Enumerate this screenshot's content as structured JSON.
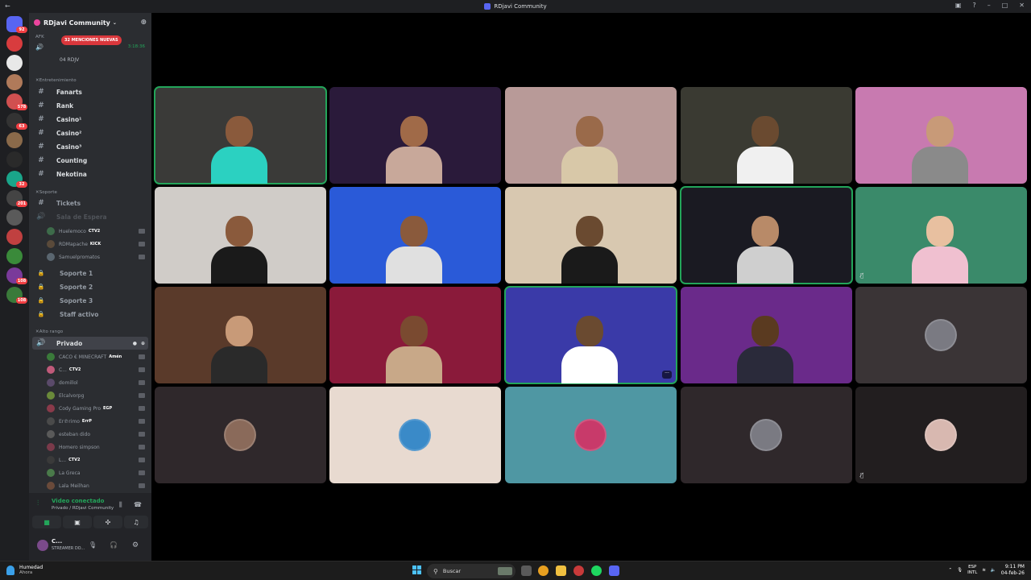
{
  "window": {
    "title": "RDjavi Community"
  },
  "servers": {
    "items": [
      {
        "icon": "discord-home-icon",
        "badge": "92",
        "color": "#5865f2"
      },
      {
        "icon": "server-icon",
        "badge": "",
        "color": "#d83c3e"
      },
      {
        "icon": "server-icon",
        "badge": "",
        "color": "#e8e8e8"
      },
      {
        "icon": "server-icon",
        "badge": "",
        "color": "#b07a5a"
      },
      {
        "icon": "server-icon",
        "badge": "578",
        "color": "#d05050"
      },
      {
        "icon": "server-icon",
        "badge": "63",
        "color": "#333"
      },
      {
        "icon": "server-icon",
        "badge": "",
        "color": "#8a6a4a"
      },
      {
        "icon": "server-icon",
        "badge": "",
        "color": "#2a2a2a"
      },
      {
        "icon": "server-icon",
        "badge": "32",
        "color": "#1aa58a"
      },
      {
        "icon": "server-icon",
        "badge": "201",
        "color": "#444"
      },
      {
        "icon": "server-icon",
        "badge": "",
        "color": "#5a5a5a"
      },
      {
        "icon": "server-icon",
        "badge": "",
        "color": "#c04040"
      },
      {
        "icon": "server-icon",
        "badge": "",
        "color": "#3a8a3a"
      },
      {
        "icon": "server-icon",
        "badge": "108",
        "color": "#7a3a9a"
      },
      {
        "icon": "server-icon",
        "badge": "108",
        "color": "#3a7a3a"
      }
    ]
  },
  "guild": {
    "name": "RDjavi Community",
    "mentions_pill": "32 MENCIONES NUEVAS",
    "top_category": "AFK",
    "afk_timer": "3:18:36",
    "afk_user": "04 RDJV",
    "categories": {
      "entretenimiento": "Entretenimiento",
      "soporte": "Soporte",
      "alto_rango": "Alto rango"
    },
    "ent_channels": [
      "Fanarts",
      "Rank",
      "Casino¹",
      "Casino²",
      "Casino³",
      "Counting",
      "Nekotina"
    ],
    "soporte_channels": [
      "Tickets",
      "Sala de Espera"
    ],
    "sala_users": [
      {
        "name": "Huelemoco",
        "tag": "CTV2",
        "color": "#3d6b4a"
      },
      {
        "name": "RDMapache",
        "tag": "KICK",
        "color": "#5a4a3a"
      },
      {
        "name": "Samuelpromatos",
        "tag": "",
        "color": "#5a6670"
      }
    ],
    "locked_channels": [
      "Soporte 1",
      "Soporte 2",
      "Soporte 3",
      "Staff activo"
    ],
    "privado_channel": "Privado",
    "privado_users": [
      {
        "name": "CACO € MINECRAFT",
        "tag": "Amén",
        "color": "#3a7a3a"
      },
      {
        "name": "C...",
        "tag": "CTV2",
        "color": "#c05a7a"
      },
      {
        "name": "domillol",
        "tag": "",
        "color": "#5a4a6a"
      },
      {
        "name": "Elcalvorpg",
        "tag": "",
        "color": "#6a8a3a"
      },
      {
        "name": "Cody Gaming Pro",
        "tag": "EGP",
        "color": "#8a3a4a"
      },
      {
        "name": "Er℗rimo",
        "tag": "ErrP",
        "color": "#4a4a4a"
      },
      {
        "name": "esteban dido",
        "tag": "",
        "color": "#5a5a5a"
      },
      {
        "name": "Homero simpson",
        "tag": "",
        "color": "#7a3a4a"
      },
      {
        "name": "L...",
        "tag": "CTV2",
        "color": "#3a3a3a"
      },
      {
        "name": "La Greca",
        "tag": "",
        "color": "#4a7a4a"
      },
      {
        "name": "Lala Meilhan",
        "tag": "",
        "color": "#6a4a3a"
      }
    ]
  },
  "voice": {
    "status": "Video conectado",
    "location": "Privado / RDjavi Community",
    "me_name": "C...",
    "me_status": "STREAMER DO..."
  },
  "tiles": [
    {
      "kind": "cam",
      "bg": "#3a3a38",
      "shirt": "#2bd1c1",
      "skin": "#8a5a3c",
      "speaking": true
    },
    {
      "kind": "cam",
      "bg": "#2a1a3a",
      "shirt": "#c8a89a",
      "skin": "#a06a48",
      "speaking": false
    },
    {
      "kind": "cam",
      "bg": "#b89a98",
      "shirt": "#d8c8a8",
      "skin": "#9a6a4a",
      "speaking": false
    },
    {
      "kind": "cam",
      "bg": "#3a3a32",
      "shirt": "#f0f0f0",
      "skin": "#6a4a30",
      "speaking": false
    },
    {
      "kind": "cam",
      "bg": "#c87ab0",
      "shirt": "#8a8a8a",
      "skin": "#c89a78",
      "speaking": false
    },
    {
      "kind": "cam",
      "bg": "#d0ccc8",
      "shirt": "#1a1a1a",
      "skin": "#8a5a3c",
      "speaking": false
    },
    {
      "kind": "cam",
      "bg": "#2a5ad8",
      "shirt": "#e0e0e0",
      "skin": "#8a5a3c",
      "speaking": false
    },
    {
      "kind": "cam",
      "bg": "#d8c8b0",
      "shirt": "#1a1a1a",
      "skin": "#6a4a30",
      "speaking": false
    },
    {
      "kind": "cam",
      "bg": "#1a1a22",
      "shirt": "#cfcfcf",
      "skin": "#b88a68",
      "speaking": true
    },
    {
      "kind": "cam",
      "bg": "#3a8a6a",
      "shirt": "#f0c0d0",
      "skin": "#e8c0a0",
      "speaking": false
    },
    {
      "kind": "cam",
      "bg": "#5a3a2a",
      "shirt": "#2a2a2a",
      "skin": "#c89a78",
      "speaking": false
    },
    {
      "kind": "cam",
      "bg": "#8a1a3a",
      "shirt": "#c8a888",
      "skin": "#7a4a30",
      "speaking": false
    },
    {
      "kind": "cam",
      "bg": "#3a3aa8",
      "shirt": "#ffffff",
      "skin": "#6a4a30",
      "speaking": true
    },
    {
      "kind": "cam",
      "bg": "#6a2a8a",
      "shirt": "#2a2a3a",
      "skin": "#5a3a20",
      "speaking": false
    },
    {
      "kind": "avatar",
      "bg": "#3a3436",
      "avatar": "#7a7a82",
      "speaking": false
    },
    {
      "kind": "avatar",
      "bg": "#2f282b",
      "avatar": "#8a6a5a",
      "speaking": false
    },
    {
      "kind": "avatar",
      "bg": "#e8dad0",
      "avatar": "#3a8ac8",
      "speaking": false
    },
    {
      "kind": "avatar",
      "bg": "#4f97a3",
      "avatar": "#c83a6a",
      "speaking": false
    },
    {
      "kind": "avatar",
      "bg": "#2f282b",
      "avatar": "#7a7a82",
      "speaking": false
    },
    {
      "kind": "avatar",
      "bg": "#221e1f",
      "avatar": "#d8b8b0",
      "speaking": false
    }
  ],
  "taskbar": {
    "weather_label": "Humedad",
    "weather_sub": "Ahora",
    "search_placeholder": "Buscar",
    "lang_top": "ESP",
    "lang_bottom": "INTL",
    "time": "9:11 PM",
    "date": "04-feb-26"
  }
}
